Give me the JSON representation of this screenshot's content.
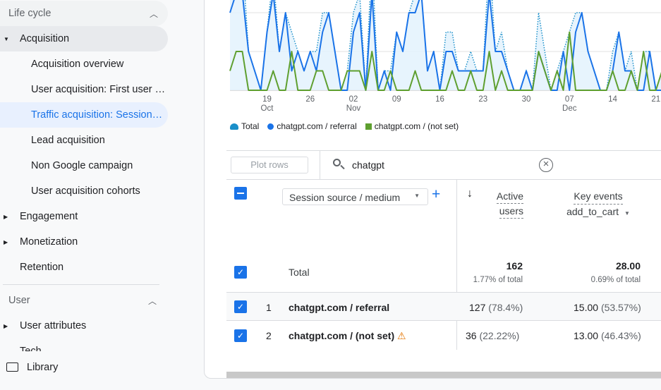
{
  "sidebar": {
    "lifecycle": "Life cycle",
    "acquisition": "Acquisition",
    "items": [
      "Acquisition overview",
      "User acquisition: First user …",
      "Traffic acquisition: Session…",
      "Lead acquisition",
      "Non Google campaign",
      "User acquisition cohorts"
    ],
    "engagement": "Engagement",
    "monetization": "Monetization",
    "retention": "Retention",
    "user": "User",
    "user_attributes": "User attributes",
    "tech": "Tech",
    "library": "Library"
  },
  "chart_data": {
    "type": "line",
    "x_ticks": [
      {
        "day": "19",
        "month": "Oct"
      },
      {
        "day": "26",
        "month": ""
      },
      {
        "day": "02",
        "month": "Nov"
      },
      {
        "day": "09",
        "month": ""
      },
      {
        "day": "16",
        "month": ""
      },
      {
        "day": "23",
        "month": ""
      },
      {
        "day": "30",
        "month": ""
      },
      {
        "day": "07",
        "month": "Dec"
      },
      {
        "day": "14",
        "month": ""
      },
      {
        "day": "21",
        "month": ""
      }
    ],
    "x_start": "2024-10-13",
    "x_end": "2024-12-23",
    "grid": true,
    "legend_placement": "bottom-left",
    "series": [
      {
        "name": "Total",
        "color": "#1a8fc9",
        "style": "dotted-area",
        "values": [
          5,
          7,
          7,
          2,
          1,
          0,
          3,
          6,
          2,
          4,
          3,
          2,
          1,
          2,
          2,
          4,
          4,
          2,
          0,
          1,
          4,
          5,
          0,
          7,
          0,
          1,
          1,
          3,
          2,
          4,
          5,
          5,
          1,
          2,
          0,
          3,
          3,
          1,
          1,
          2,
          1,
          1,
          7,
          2,
          3,
          1,
          0,
          0,
          1,
          0,
          4,
          2,
          0,
          1,
          2,
          3,
          4,
          4,
          2,
          1,
          0,
          0,
          2,
          3,
          1,
          2,
          0,
          2,
          2,
          0,
          1
        ]
      },
      {
        "name": "chatgpt.com / referral",
        "color": "#1a73e8",
        "values": [
          4,
          5,
          5,
          2,
          1,
          0,
          3,
          5,
          2,
          4,
          1,
          2,
          1,
          2,
          1,
          3,
          4,
          2,
          0,
          0,
          3,
          4,
          0,
          5,
          0,
          1,
          0,
          3,
          2,
          4,
          4,
          5,
          1,
          2,
          0,
          2,
          2,
          1,
          1,
          1,
          1,
          1,
          5,
          2,
          2,
          1,
          0,
          0,
          1,
          0,
          2,
          1,
          0,
          0,
          2,
          0,
          3,
          4,
          2,
          1,
          0,
          0,
          1,
          3,
          1,
          1,
          0,
          0,
          2,
          0,
          0
        ]
      },
      {
        "name": "chatgpt.com / (not set)",
        "color": "#5e9f2f",
        "values": [
          1,
          2,
          2,
          0,
          0,
          0,
          0,
          1,
          0,
          0,
          2,
          0,
          0,
          0,
          1,
          1,
          0,
          0,
          0,
          1,
          1,
          1,
          0,
          2,
          0,
          0,
          1,
          0,
          0,
          0,
          1,
          0,
          0,
          0,
          0,
          0,
          1,
          0,
          0,
          1,
          0,
          0,
          2,
          0,
          1,
          0,
          0,
          0,
          0,
          0,
          2,
          1,
          0,
          1,
          0,
          3,
          0,
          0,
          0,
          0,
          0,
          0,
          1,
          0,
          0,
          1,
          0,
          2,
          0,
          0,
          1
        ]
      }
    ]
  },
  "toolbar": {
    "plot_rows": "Plot rows",
    "search_value": "chatgpt"
  },
  "table": {
    "dimension": "Session source / medium",
    "col_active": [
      "Active",
      "users"
    ],
    "col_key": "Key events",
    "col_key_sub": "add_to_cart",
    "total_label": "Total",
    "total_active": "162",
    "total_active_pct": "1.77% of total",
    "total_key": "28.00",
    "total_key_pct": "0.69% of total",
    "rows": [
      {
        "n": "1",
        "name": "chatgpt.com / referral",
        "active": "127",
        "active_pct": "(78.4%)",
        "key": "15.00",
        "key_pct": "(53.57%)"
      },
      {
        "n": "2",
        "name": "chatgpt.com / (not set)",
        "active": "36",
        "active_pct": "(22.22%)",
        "key": "13.00",
        "key_pct": "(46.43%)"
      }
    ]
  },
  "colors": {
    "accent": "#1a73e8",
    "selected_bg": "#e8f0fe",
    "warning": "#e37400"
  }
}
